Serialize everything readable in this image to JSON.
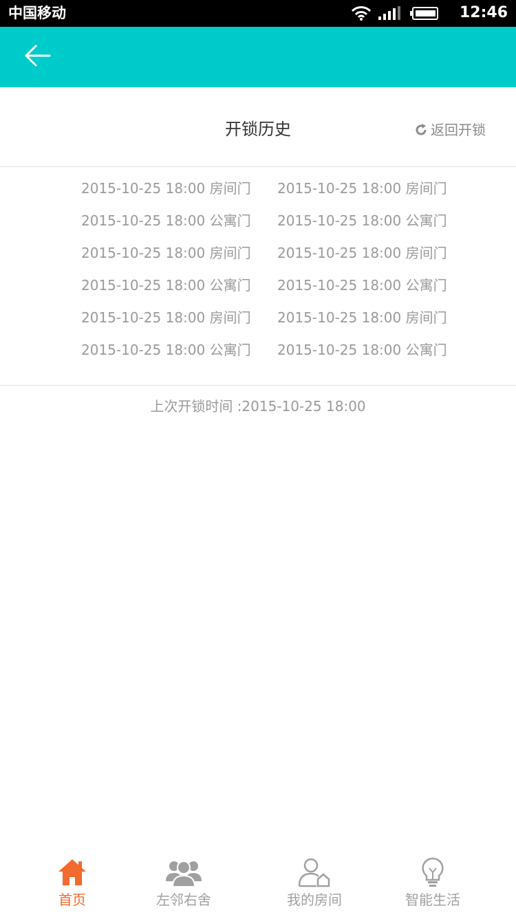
{
  "status_bar": {
    "carrier": "中国移动",
    "time": "12:46"
  },
  "header": {
    "title": "开锁历史",
    "return_label": "返回开锁"
  },
  "history": [
    {
      "left": "2015-10-25 18:00 房间门",
      "right": "2015-10-25 18:00 房间门"
    },
    {
      "left": "2015-10-25 18:00 公寓门",
      "right": "2015-10-25 18:00 公寓门"
    },
    {
      "left": "2015-10-25 18:00 房间门",
      "right": "2015-10-25 18:00 房间门"
    },
    {
      "left": "2015-10-25 18:00 公寓门",
      "right": "2015-10-25 18:00 公寓门"
    },
    {
      "left": "2015-10-25 18:00 房间门",
      "right": "2015-10-25 18:00 房间门"
    },
    {
      "left": "2015-10-25 18:00 公寓门",
      "right": "2015-10-25 18:00 公寓门"
    }
  ],
  "last_unlock": "上次开锁时间 :2015-10-25 18:00",
  "tabs": [
    {
      "label": "首页",
      "icon": "home-icon",
      "active": true
    },
    {
      "label": "左邻右舍",
      "icon": "neighbors-icon",
      "active": false
    },
    {
      "label": "我的房间",
      "icon": "my-room-icon",
      "active": false
    },
    {
      "label": "智能生活",
      "icon": "lightbulb-icon",
      "active": false
    }
  ],
  "colors": {
    "accent": "#00cbcb",
    "tab_active": "#f26b2e",
    "text_muted": "#9a9a9a"
  }
}
